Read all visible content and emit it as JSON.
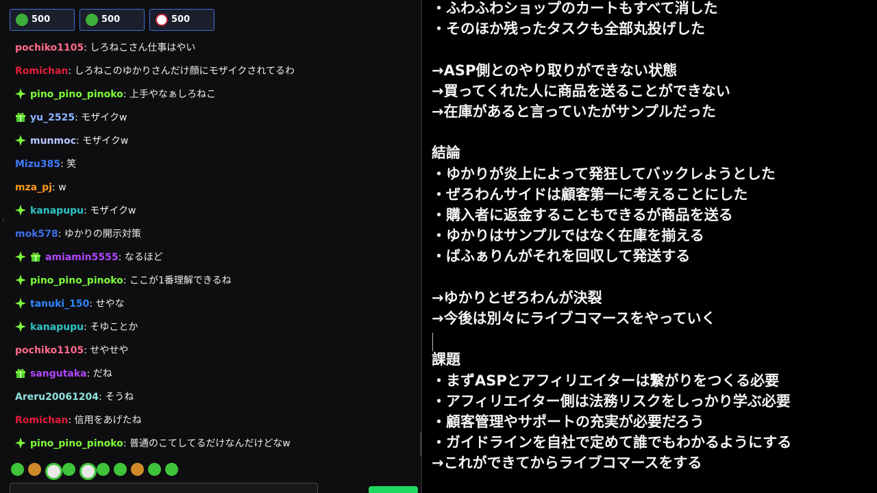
{
  "chat": {
    "badges": [
      {
        "icon": "frog-badge-icon",
        "value": "500"
      },
      {
        "icon": "frog-badge-icon",
        "value": "500"
      },
      {
        "icon": "avatar-badge-icon",
        "value": "500"
      }
    ],
    "messages": [
      {
        "user": "pochiko1105",
        "text": "しろねこさん仕事はやい",
        "color": "#ff6a8b",
        "badge": "none"
      },
      {
        "user": "Romichan",
        "text": "しろねこのゆかりさんだけ顔にモザイクされてるわ",
        "color": "#e51d3b",
        "badge": "none"
      },
      {
        "user": "pino_pino_pinoko",
        "text": "上手やなぁしろねこ",
        "color": "#7dfc3c",
        "badge": "sparkle"
      },
      {
        "user": "yu_2525",
        "text": "モザイクw",
        "color": "#8ab4ff",
        "badge": "gift"
      },
      {
        "user": "munmoc",
        "text": "モザイクw",
        "color": "#b8c4ff",
        "badge": "sparkle"
      },
      {
        "user": "Mizu385",
        "text": "笑",
        "color": "#3f7bff",
        "badge": "none"
      },
      {
        "user": "mza_pj",
        "text": "w",
        "color": "#ff9a1a",
        "badge": "none"
      },
      {
        "user": "kanapupu",
        "text": "モザイクw",
        "color": "#2ec4c4",
        "badge": "sparkle"
      },
      {
        "user": "mok578",
        "text": "ゆかりの開示対策",
        "color": "#3f6fe8",
        "badge": "none"
      },
      {
        "user": "amiamin5555",
        "text": "なるほど",
        "color": "#b146ff",
        "badge": "sparkle-gift"
      },
      {
        "user": "pino_pino_pinoko",
        "text": "ここが1番理解できるね",
        "color": "#7dfc3c",
        "badge": "sparkle"
      },
      {
        "user": "tanuki_150",
        "text": "せやな",
        "color": "#2e86ff",
        "badge": "sparkle"
      },
      {
        "user": "kanapupu",
        "text": "そゆことか",
        "color": "#2ec4c4",
        "badge": "sparkle"
      },
      {
        "user": "pochiko1105",
        "text": "せやせや",
        "color": "#ff6a8b",
        "badge": "none"
      },
      {
        "user": "sangutaka",
        "text": "だね",
        "color": "#b146ff",
        "badge": "gift"
      },
      {
        "user": "Areru20061204",
        "text": "そうね",
        "color": "#8fe3e0",
        "badge": "none"
      },
      {
        "user": "Romichan",
        "text": "信用をあげたね",
        "color": "#e51d3b",
        "badge": "none"
      },
      {
        "user": "pino_pino_pinoko",
        "text": "普通のこてしてるだけなんだけどなw",
        "color": "#7dfc3c",
        "badge": "sparkle"
      }
    ],
    "separator": ": ",
    "emotes": [
      "frog-emote-icon",
      "face-emote-icon",
      "panda-emote-icon",
      "frog-emote-icon",
      "panda-emote-icon",
      "frog-emote-icon",
      "frog-emote-icon",
      "face-emote-icon",
      "frog-emote-icon",
      "frog-emote-icon"
    ]
  },
  "notes": {
    "lines": [
      "・ふわふわショップのカートもすべて消した",
      "・そのほか残ったタスクも全部丸投げした",
      "",
      "→ASP側とのやり取りができない状態",
      "→買ってくれた人に商品を送ることができない",
      "→在庫があると言っていたがサンプルだった",
      "",
      "結論",
      "・ゆかりが炎上によって発狂してバックレようとした",
      "・ぜろわんサイドは顧客第一に考えることにした",
      "・購入者に返金することもできるが商品を送る",
      "・ゆかりはサンプルではなく在庫を揃える",
      "・ばふぁりんがそれを回収して発送する",
      "",
      "→ゆかりとぜろわんが決裂",
      "→今後は別々にライブコマースをやっていく",
      "",
      "課題",
      "・まずASPとアフィリエイターは繋がりをつくる必要",
      "・アフィリエイター側は法務リスクをしっかり学ぶ必要",
      "・顧客管理やサポートの充実が必要だろう",
      "・ガイドラインを自社で定めて誰でもわかるようにする",
      "→これができてからライブコマースをする"
    ]
  }
}
